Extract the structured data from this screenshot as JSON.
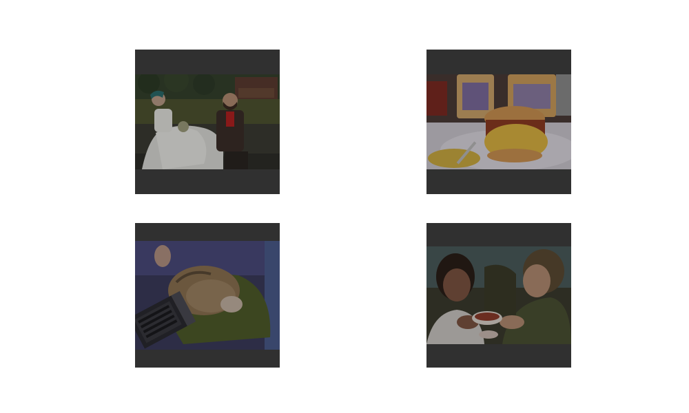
{
  "thumbnails": [
    {
      "id": "tile-1",
      "subject": "wedding-couple-on-bench"
    },
    {
      "id": "tile-2",
      "subject": "breakfast-sandwich-with-mugs"
    },
    {
      "id": "tile-3",
      "subject": "cat-sleeping-on-lap-with-laptop"
    },
    {
      "id": "tile-4",
      "subject": "two-people-sharing-tea"
    }
  ],
  "colors": {
    "letterbox": "#3e3e3e",
    "background": "#ffffff"
  }
}
